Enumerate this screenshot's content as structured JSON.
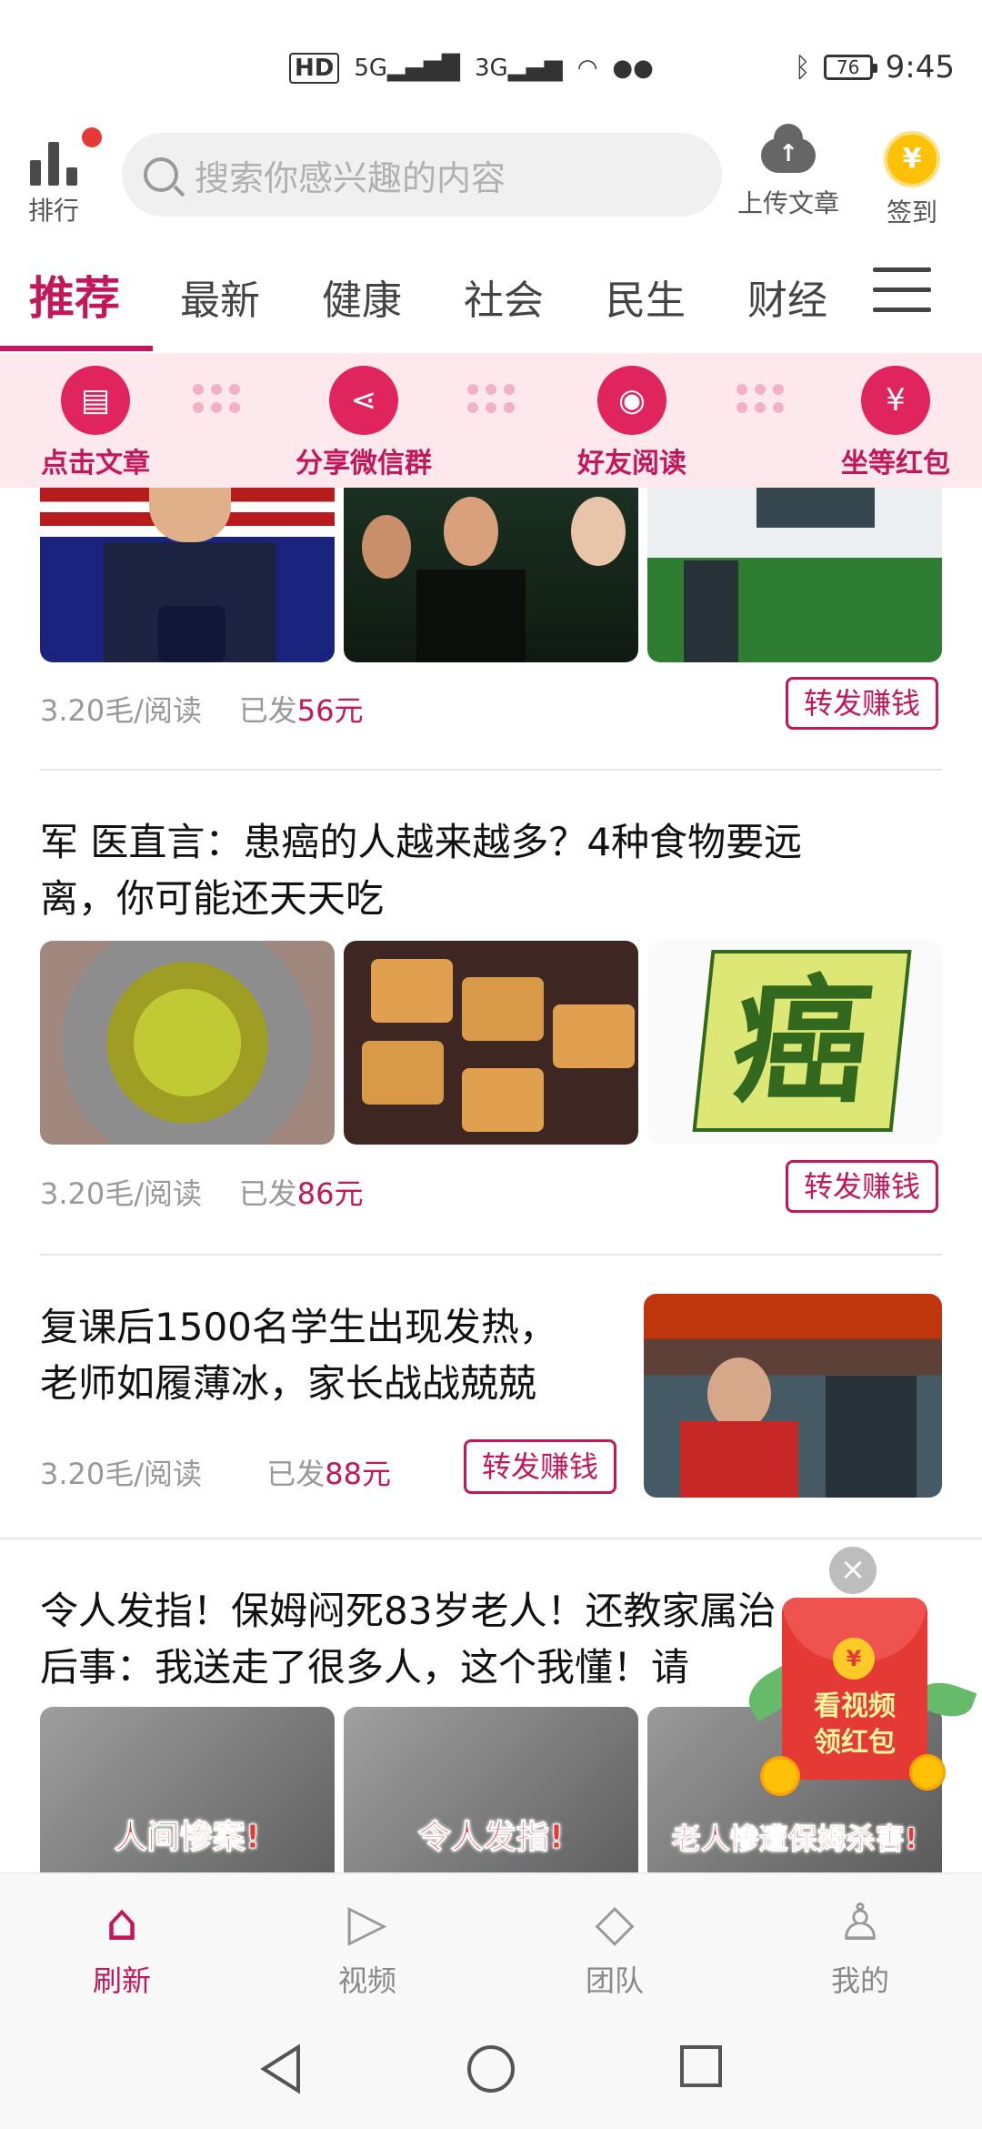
{
  "status_bar": {
    "network_icons": [
      "HD",
      "5G",
      "3G",
      "wifi",
      "wechat"
    ],
    "battery": "76",
    "time": "9:45"
  },
  "top": {
    "rank_label": "排行",
    "search_placeholder": "搜索你感兴趣的内容",
    "upload_label": "上传文章",
    "checkin_label": "签到",
    "checkin_symbol": "¥"
  },
  "tabs": [
    "推荐",
    "最新",
    "健康",
    "社会",
    "民生",
    "财经"
  ],
  "steps": [
    "点击文章",
    "分享微信群",
    "好友阅读",
    "坐等红包"
  ],
  "feed": [
    {
      "title": "",
      "rate": "3.20毛/阅读",
      "sent_prefix": "已发",
      "sent_amount": "56元",
      "forward_label": "转发赚钱"
    },
    {
      "title_line1": "军 医直言：患癌的人越来越多？4种食物要远",
      "title_line2": "离，你可能还天天吃",
      "image3_text": "癌",
      "rate": "3.20毛/阅读",
      "sent_prefix": "已发",
      "sent_amount": "86元",
      "forward_label": "转发赚钱"
    },
    {
      "title_line1": "复课后1500名学生出现发热，",
      "title_line2": "老师如履薄冰，家长战战兢兢",
      "rate": "3.20毛/阅读",
      "sent_prefix": "已发",
      "sent_amount": "88元",
      "forward_label": "转发赚钱"
    },
    {
      "title_line1": "令人发指！保姆闷死83岁老人！还教家属治",
      "title_line2": "后事：我送走了很多人，这个我懂！请",
      "image_captions": [
        "人间惨案!",
        "令人发指!",
        "老人惨遭保姆杀害!"
      ]
    }
  ],
  "float_ad": {
    "close": "×",
    "coin": "¥",
    "line1": "看视频",
    "line2": "领红包"
  },
  "bottom_nav": [
    {
      "label": "刷新",
      "icon": "home-icon",
      "active": true
    },
    {
      "label": "视频",
      "icon": "play-icon",
      "active": false
    },
    {
      "label": "团队",
      "icon": "diamond-icon",
      "active": false
    },
    {
      "label": "我的",
      "icon": "person-icon",
      "active": false
    }
  ],
  "colors": {
    "accent": "#c2185b",
    "steps_bg": "#fde8ee"
  }
}
